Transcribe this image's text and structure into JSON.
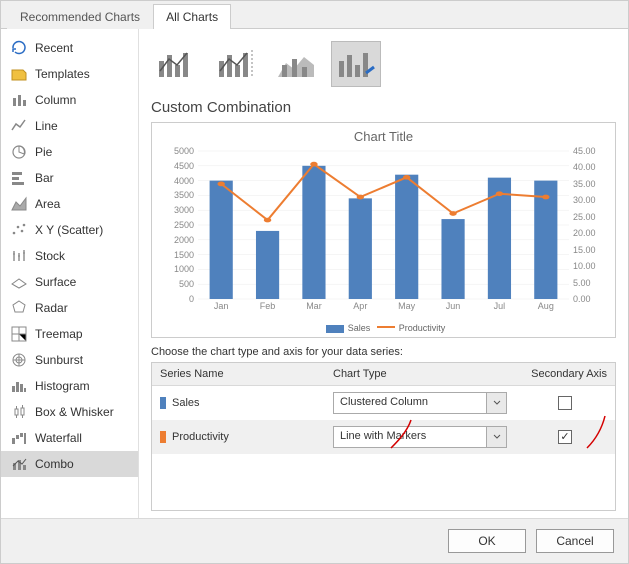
{
  "tabs": {
    "recommended": "Recommended Charts",
    "all": "All Charts"
  },
  "sidebar": {
    "items": [
      {
        "label": "Recent"
      },
      {
        "label": "Templates"
      },
      {
        "label": "Column"
      },
      {
        "label": "Line"
      },
      {
        "label": "Pie"
      },
      {
        "label": "Bar"
      },
      {
        "label": "Area"
      },
      {
        "label": "X Y (Scatter)"
      },
      {
        "label": "Stock"
      },
      {
        "label": "Surface"
      },
      {
        "label": "Radar"
      },
      {
        "label": "Treemap"
      },
      {
        "label": "Sunburst"
      },
      {
        "label": "Histogram"
      },
      {
        "label": "Box & Whisker"
      },
      {
        "label": "Waterfall"
      },
      {
        "label": "Combo"
      }
    ]
  },
  "section_title": "Custom Combination",
  "chart_data": {
    "type": "combo",
    "title": "Chart Title",
    "categories": [
      "Jan",
      "Feb",
      "Mar",
      "Apr",
      "May",
      "Jun",
      "Jul",
      "Aug"
    ],
    "y_left": {
      "min": 0,
      "max": 5000,
      "step": 500
    },
    "y_right": {
      "min": 0,
      "max": 45,
      "step": 5
    },
    "series": [
      {
        "name": "Sales",
        "type": "bar",
        "axis": "left",
        "color": "#4f81bd",
        "values": [
          4000,
          2300,
          4500,
          3400,
          4200,
          2700,
          4100,
          4000
        ]
      },
      {
        "name": "Productivity",
        "type": "line_markers",
        "axis": "right",
        "color": "#ed7d31",
        "values": [
          35,
          24,
          41,
          31,
          37,
          26,
          32,
          31
        ]
      }
    ],
    "legend": [
      "Sales",
      "Productivity"
    ]
  },
  "series_area": {
    "prompt": "Choose the chart type and axis for your data series:",
    "head": {
      "name": "Series Name",
      "type": "Chart Type",
      "axis": "Secondary Axis"
    },
    "rows": [
      {
        "name": "Sales",
        "color": "#4f81bd",
        "chart_type": "Clustered Column",
        "secondary": false
      },
      {
        "name": "Productivity",
        "color": "#ed7d31",
        "chart_type": "Line with Markers",
        "secondary": true
      }
    ]
  },
  "footer": {
    "ok": "OK",
    "cancel": "Cancel"
  }
}
